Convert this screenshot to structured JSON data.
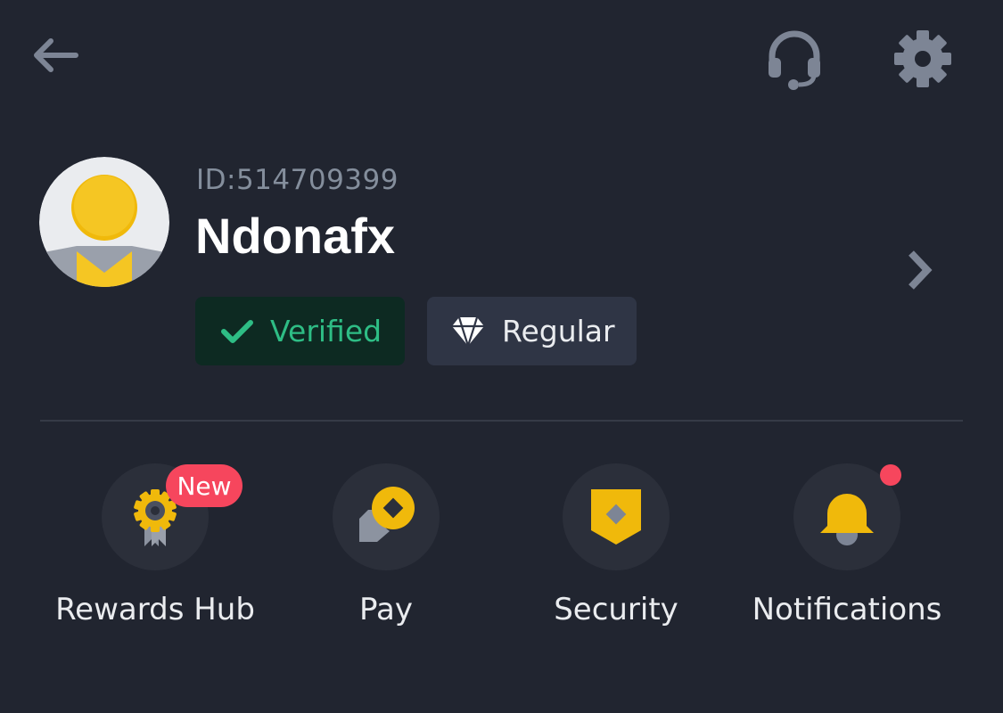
{
  "header": {
    "back_icon": "arrow-left-icon",
    "support_icon": "headset-icon",
    "settings_icon": "gear-icon"
  },
  "profile": {
    "id_text": "ID:514709399",
    "username": "Ndonafx",
    "avatar_icon": "user-avatar",
    "verified_label": "Verified",
    "vip_label": "Regular"
  },
  "quick_actions": [
    {
      "label": "Rewards Hub",
      "icon": "award-ribbon-icon",
      "badge": "New"
    },
    {
      "label": "Pay",
      "icon": "pay-icon"
    },
    {
      "label": "Security",
      "icon": "shield-icon"
    },
    {
      "label": "Notifications",
      "icon": "bell-icon"
    }
  ],
  "colors": {
    "background": "#212530",
    "accent_yellow": "#f0b90b",
    "green": "#2ebd85",
    "red_badge": "#f6465d",
    "muted": "#848e9c"
  }
}
